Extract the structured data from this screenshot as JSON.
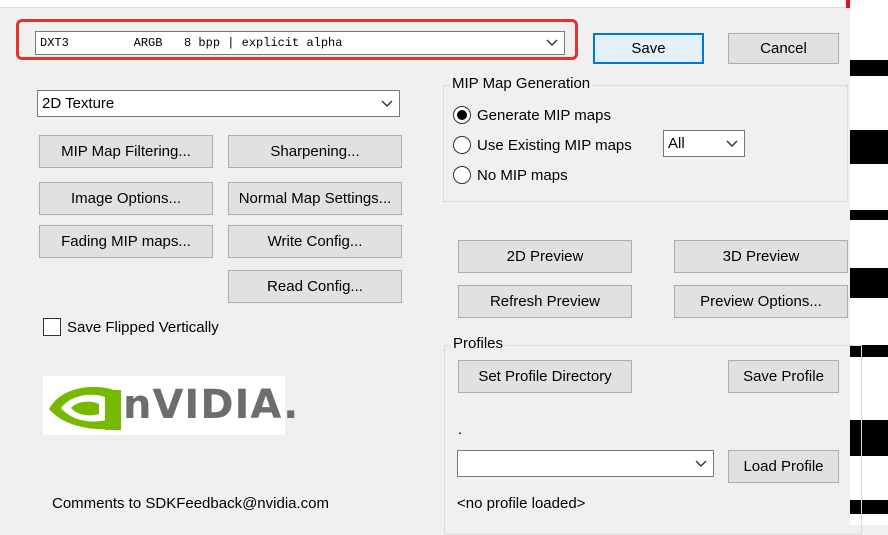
{
  "format_combo": {
    "value": "DXT3         ARGB   8 bpp | explicit alpha"
  },
  "buttons": {
    "save": "Save",
    "cancel": "Cancel",
    "mip_map_filtering": "MIP Map Filtering...",
    "sharpening": "Sharpening...",
    "image_options": "Image Options...",
    "normal_map_settings": "Normal Map Settings...",
    "fading_mip_maps": "Fading MIP maps...",
    "write_config": "Write Config...",
    "read_config": "Read Config...",
    "preview_2d": "2D Preview",
    "preview_3d": "3D Preview",
    "refresh_preview": "Refresh Preview",
    "preview_options": "Preview Options...",
    "set_profile_directory": "Set Profile Directory",
    "save_profile": "Save Profile",
    "load_profile": "Load Profile"
  },
  "texture_combo": {
    "value": "2D Texture"
  },
  "mip_group": {
    "label": "MIP Map Generation",
    "options": [
      "Generate MIP maps",
      "Use Existing MIP maps",
      "No MIP maps"
    ],
    "selected_index": 0,
    "count_combo_value": "All"
  },
  "save_flipped": {
    "label": "Save Flipped Vertically",
    "checked": false
  },
  "logo_text": "nVIDIA.",
  "comments": "Comments to SDKFeedback@nvidia.com",
  "profiles": {
    "label": "Profiles",
    "dot_text": ".",
    "profile_combo_value": "",
    "status": "<no profile loaded>"
  },
  "colors": {
    "accent": "#0078d7",
    "highlight": "#e5312b",
    "nvidia_green": "#76b900"
  }
}
